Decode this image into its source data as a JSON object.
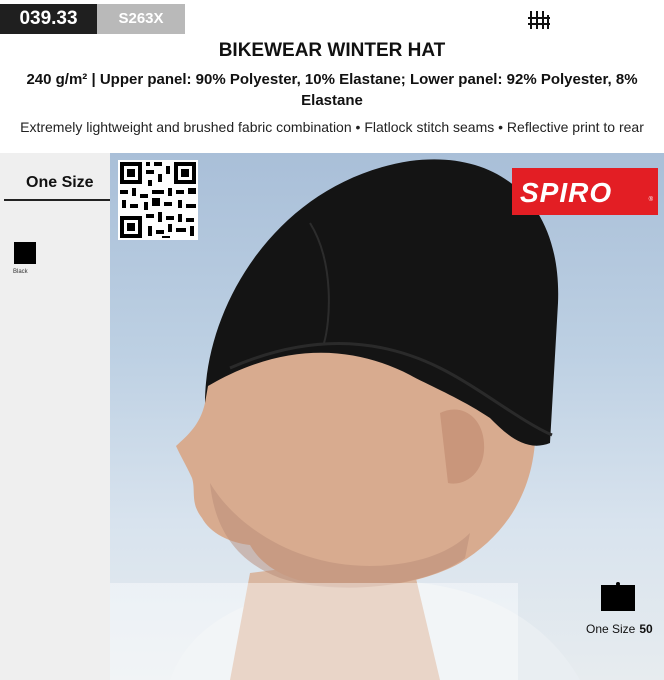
{
  "header": {
    "product_code": "039.33",
    "supplier_code": "S263X"
  },
  "product": {
    "title": "BIKEWEAR WINTER HAT",
    "spec": "240 g/m² | Upper panel: 90% Polyester, 10% Elastane; Lower panel: 92% Polyester, 8% Elastane",
    "features": "Extremely lightweight and brushed fabric combination • Flatlock stitch seams • Reflective print to rear"
  },
  "sizes": {
    "tab_label": "One Size"
  },
  "colors": [
    {
      "name": "Black",
      "hex": "#000000"
    }
  ],
  "brand": {
    "name": "SPIRO",
    "mark": "®",
    "color": "#e31e24"
  },
  "size_chart": {
    "size": "One Size",
    "value": "50"
  },
  "icons": {
    "top": "garment-care-icon",
    "qr": "qr-code"
  }
}
